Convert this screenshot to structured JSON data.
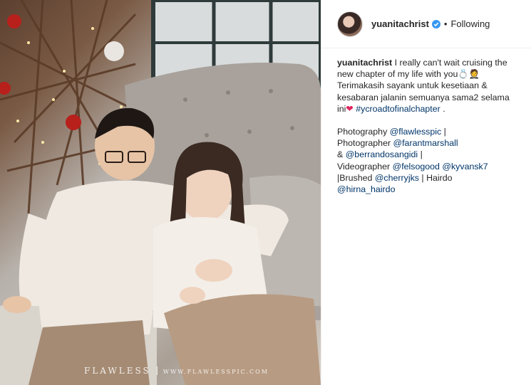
{
  "post": {
    "username": "yuanitachrist",
    "follow_status": "Following",
    "separator": "•",
    "watermark": {
      "brand": "FLAWLESS",
      "site": "WWW.FLAWLESSPIC.COM"
    },
    "caption": {
      "line1_text": "I really can't wait cruising the new chapter of my life with you",
      "line1_emoji": "💍🤵",
      "line2_text": "Terimakasih sayank untuk kesetiaan & kesabaran jalanin semuanya sama2 selama ini",
      "heart": "❤",
      "hashtag": "#ycroadtofinalchapter",
      "period": ".",
      "credits": [
        {
          "label": "Photography ",
          "handle": "@flawlesspic",
          "after": " |"
        },
        {
          "label": "Photographer ",
          "handle": "@farantmarshall",
          "after": ""
        },
        {
          "label": "& ",
          "handle": "@berrandosangidi",
          "after": " |"
        },
        {
          "label": "Videographer ",
          "handle": "@felsogood",
          "after": " "
        },
        {
          "label": "",
          "handle": "@kyvansk7",
          "after": ""
        },
        {
          "label": "|Brushed ",
          "handle": "@cherryjks",
          "after": " | Hairdo"
        },
        {
          "label": "",
          "handle": "@hirna_hairdo",
          "after": ""
        }
      ]
    }
  },
  "colors": {
    "link": "#003569",
    "verified": "#3897f0",
    "heart": "#e0245e"
  },
  "icons": {
    "verified": "verified-badge-icon"
  }
}
